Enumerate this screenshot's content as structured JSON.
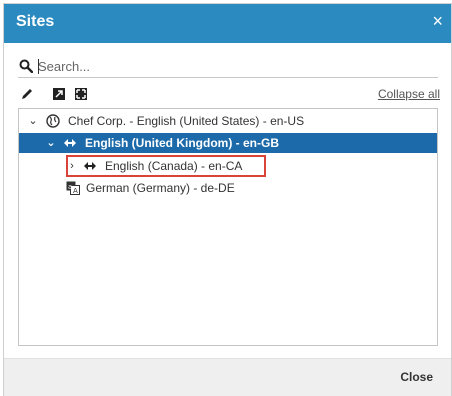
{
  "dialog": {
    "title": "Sites",
    "close_glyph": "×",
    "close_icon": "close-icon"
  },
  "search": {
    "placeholder": "Search...",
    "value": "",
    "icon": "search-icon"
  },
  "toolbar": {
    "icons": [
      "edit-icon",
      "expand-icon",
      "fullscreen-icon"
    ],
    "collapse_label": "Collapse all"
  },
  "tree": {
    "items": [
      {
        "label": "Chef Corp. - English (United States) - en-US",
        "arrow": "⌄",
        "icon": "globe-icon",
        "selected": false
      },
      {
        "label": "English (United Kingdom) - en-GB",
        "arrow": "⌄",
        "icon": "bidirectional-arrow-icon",
        "selected": true
      },
      {
        "label": "English (Canada) - en-CA",
        "arrow": "›",
        "icon": "bidirectional-arrow-icon",
        "selected": false
      },
      {
        "label": "German (Germany) - de-DE",
        "arrow": "",
        "icon": "translate-icon",
        "selected": false
      }
    ]
  },
  "footer": {
    "close_label": "Close"
  },
  "colors": {
    "titlebar": "#2b8bc0",
    "selected_row": "#1c6aa9",
    "highlight_box": "#d9443a",
    "footer": "#efefef"
  }
}
